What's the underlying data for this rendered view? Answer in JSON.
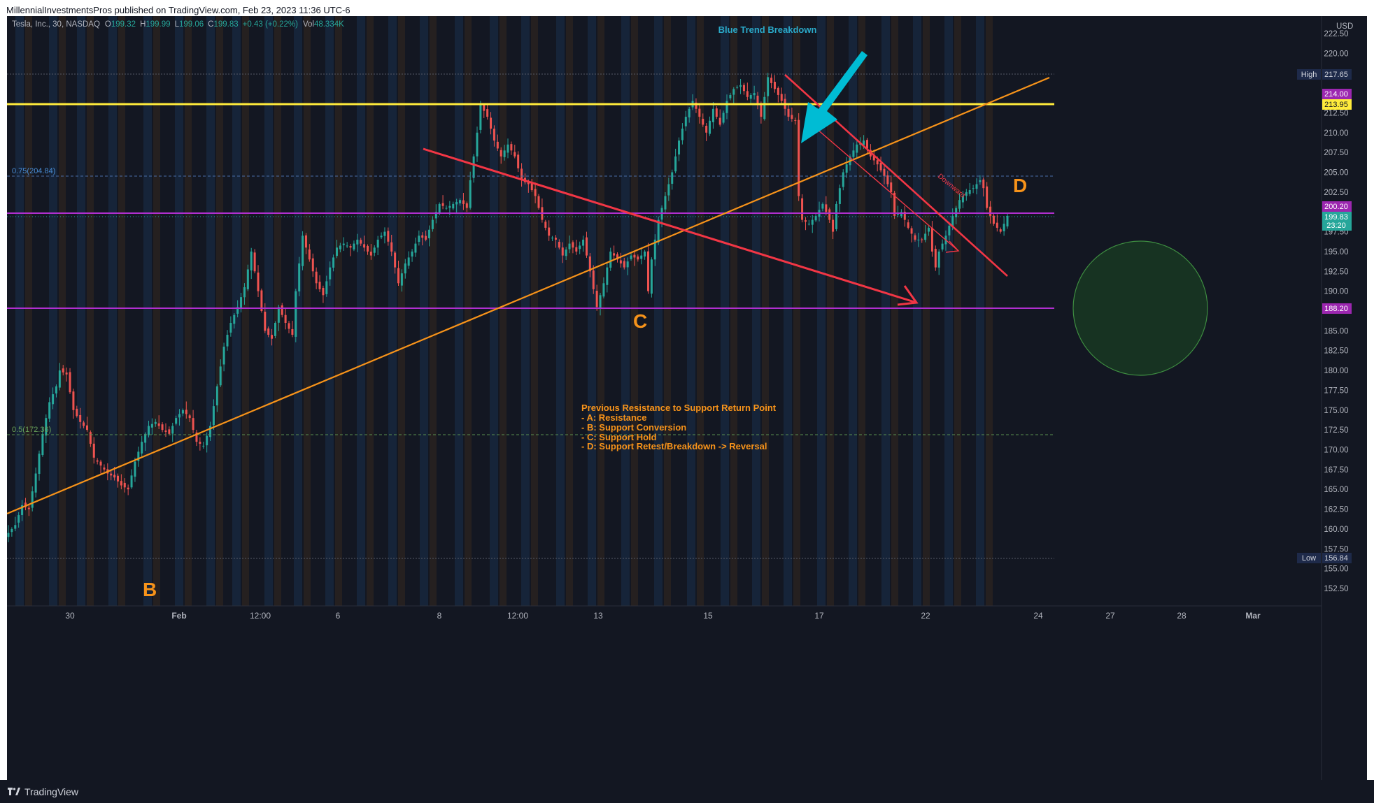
{
  "header": {
    "published": "MillennialInvestmentsPros published on TradingView.com, Feb 23, 2023 11:36 UTC-6"
  },
  "legend": {
    "symbol": "Tesla, Inc., 30, NASDAQ",
    "o_label": "O",
    "o_val": "199.32",
    "h_label": "H",
    "h_val": "199.99",
    "l_label": "L",
    "l_val": "199.06",
    "c_label": "C",
    "c_val": "199.83",
    "change": "+0.43 (+0.22%)",
    "vol_label": "Vol",
    "vol_val": "48.334K"
  },
  "annotations": {
    "title": "Blue Trend Breakdown",
    "label_b": "B",
    "label_c": "C",
    "label_d": "D",
    "downward": "Downward",
    "note_lines": [
      "Previous Resistance to Support Return Point",
      "- A: Resistance",
      "- B: Support Conversion",
      "- C: Support Hold",
      "- D: Support Retest/Breakdown -> Reversal"
    ],
    "fib_075": "0.75(204.84)",
    "fib_05": "0.5(172.36)"
  },
  "axis": {
    "currency": "USD",
    "high_label": "High",
    "high_val": "217.65",
    "low_label": "Low",
    "low_val": "156.84",
    "tag_214": "214.00",
    "tag_21395": "213.95",
    "tag_20020": "200.20",
    "tag_last": "199.83",
    "tag_timer": "23:20",
    "tag_18820": "188.20"
  },
  "footer": {
    "brand": "TradingView"
  },
  "colors": {
    "background": "#131722",
    "up": "#26a69a",
    "down": "#ef5350",
    "orange": "#f7931a",
    "yellow": "#ffeb3b",
    "magenta": "#9c27b0",
    "red_line": "#f23645",
    "cyan_arrow": "#00bcd4",
    "circle": "#1b5e20"
  },
  "chart_data": {
    "type": "candlestick",
    "symbol": "Tesla, Inc.",
    "interval": "30",
    "exchange": "NASDAQ",
    "ylim": [
      151.0,
      224.0
    ],
    "y_ticks": [
      152.5,
      155.0,
      157.5,
      160.0,
      162.5,
      165.0,
      167.5,
      170.0,
      172.5,
      175.0,
      177.5,
      180.0,
      182.5,
      185.0,
      187.5,
      190.0,
      192.5,
      195.0,
      197.5,
      200.0,
      202.5,
      205.0,
      207.5,
      210.0,
      212.5,
      215.0,
      217.5,
      220.0,
      222.5
    ],
    "x_tick_labels": [
      "30",
      "Feb",
      "12:00",
      "6",
      "8",
      "12:00",
      "13",
      "15",
      "17",
      "22",
      "24",
      "27",
      "28",
      "Mar"
    ],
    "price_path": [
      [
        0,
        159.5
      ],
      [
        2,
        160.5
      ],
      [
        4,
        163.0
      ],
      [
        6,
        162.5
      ],
      [
        8,
        167.0
      ],
      [
        10,
        172.0
      ],
      [
        12,
        176.0
      ],
      [
        14,
        178.0
      ],
      [
        15,
        180.0
      ],
      [
        17,
        179.5
      ],
      [
        19,
        175.0
      ],
      [
        21,
        173.5
      ],
      [
        23,
        172.5
      ],
      [
        25,
        169.0
      ],
      [
        27,
        168.0
      ],
      [
        29,
        167.0
      ],
      [
        31,
        166.5
      ],
      [
        33,
        165.5
      ],
      [
        35,
        165.0
      ],
      [
        37,
        168.5
      ],
      [
        39,
        171.0
      ],
      [
        41,
        173.0
      ],
      [
        43,
        173.5
      ],
      [
        45,
        172.5
      ],
      [
        47,
        172.0
      ],
      [
        49,
        174.0
      ],
      [
        51,
        175.0
      ],
      [
        53,
        174.0
      ],
      [
        55,
        171.0
      ],
      [
        57,
        170.5
      ],
      [
        59,
        173.0
      ],
      [
        61,
        178.0
      ],
      [
        63,
        183.0
      ],
      [
        65,
        186.0
      ],
      [
        67,
        188.0
      ],
      [
        69,
        190.5
      ],
      [
        71,
        195.0
      ],
      [
        73,
        190.0
      ],
      [
        75,
        185.0
      ],
      [
        77,
        184.0
      ],
      [
        79,
        188.0
      ],
      [
        81,
        186.0
      ],
      [
        83,
        184.5
      ],
      [
        84,
        190.0
      ],
      [
        86,
        197.0
      ],
      [
        88,
        194.0
      ],
      [
        90,
        191.0
      ],
      [
        92,
        189.5
      ],
      [
        94,
        193.0
      ],
      [
        96,
        195.5
      ],
      [
        98,
        196.0
      ],
      [
        100,
        195.5
      ],
      [
        102,
        196.5
      ],
      [
        104,
        195.5
      ],
      [
        106,
        194.5
      ],
      [
        108,
        196.5
      ],
      [
        110,
        197.5
      ],
      [
        112,
        195.0
      ],
      [
        114,
        191.0
      ],
      [
        116,
        193.5
      ],
      [
        118,
        195.0
      ],
      [
        120,
        197.0
      ],
      [
        122,
        196.5
      ],
      [
        124,
        199.0
      ],
      [
        126,
        201.0
      ],
      [
        128,
        200.5
      ],
      [
        130,
        201.0
      ],
      [
        132,
        201.5
      ],
      [
        134,
        200.5
      ],
      [
        135,
        204.0
      ],
      [
        137,
        210.0
      ],
      [
        138,
        213.5
      ],
      [
        140,
        212.0
      ],
      [
        142,
        209.0
      ],
      [
        144,
        207.0
      ],
      [
        146,
        208.5
      ],
      [
        148,
        207.0
      ],
      [
        150,
        204.0
      ],
      [
        152,
        203.5
      ],
      [
        154,
        202.0
      ],
      [
        156,
        199.0
      ],
      [
        158,
        197.0
      ],
      [
        160,
        196.5
      ],
      [
        162,
        194.5
      ],
      [
        164,
        196.0
      ],
      [
        166,
        195.0
      ],
      [
        168,
        196.5
      ],
      [
        170,
        192.5
      ],
      [
        172,
        188.0
      ],
      [
        174,
        191.0
      ],
      [
        176,
        195.0
      ],
      [
        178,
        194.0
      ],
      [
        180,
        193.0
      ],
      [
        182,
        194.5
      ],
      [
        184,
        194.0
      ],
      [
        186,
        195.0
      ],
      [
        187,
        190.0
      ],
      [
        188,
        194.0
      ],
      [
        190,
        199.0
      ],
      [
        192,
        202.0
      ],
      [
        194,
        205.0
      ],
      [
        196,
        209.0
      ],
      [
        198,
        212.0
      ],
      [
        200,
        214.0
      ],
      [
        202,
        212.0
      ],
      [
        204,
        210.0
      ],
      [
        206,
        213.0
      ],
      [
        208,
        211.0
      ],
      [
        210,
        214.0
      ],
      [
        212,
        215.5
      ],
      [
        214,
        216.0
      ],
      [
        216,
        214.5
      ],
      [
        218,
        215.0
      ],
      [
        220,
        212.0
      ],
      [
        222,
        217.0
      ],
      [
        224,
        215.5
      ],
      [
        226,
        214.0
      ],
      [
        228,
        212.0
      ],
      [
        230,
        211.5
      ],
      [
        231,
        202.0
      ],
      [
        232,
        199.0
      ],
      [
        234,
        198.5
      ],
      [
        236,
        199.5
      ],
      [
        238,
        201.0
      ],
      [
        240,
        199.0
      ],
      [
        241,
        197.5
      ],
      [
        242,
        201.0
      ],
      [
        244,
        205.0
      ],
      [
        246,
        207.0
      ],
      [
        248,
        208.5
      ],
      [
        250,
        209.0
      ],
      [
        252,
        207.0
      ],
      [
        254,
        206.0
      ],
      [
        256,
        204.5
      ],
      [
        258,
        202.5
      ],
      [
        259,
        199.5
      ],
      [
        261,
        200.0
      ],
      [
        263,
        198.0
      ],
      [
        265,
        196.5
      ],
      [
        267,
        196.5
      ],
      [
        269,
        198.0
      ],
      [
        270,
        195.0
      ],
      [
        271,
        193.0
      ],
      [
        272,
        195.0
      ],
      [
        274,
        197.0
      ],
      [
        276,
        199.5
      ],
      [
        278,
        201.5
      ],
      [
        280,
        202.5
      ],
      [
        282,
        203.0
      ],
      [
        284,
        204.0
      ],
      [
        285,
        203.0
      ],
      [
        286,
        200.5
      ],
      [
        288,
        198.5
      ],
      [
        290,
        197.5
      ],
      [
        292,
        199.5
      ]
    ],
    "lines": {
      "resistance_A": 213.95,
      "level_214": 214.0,
      "level_200_20": 200.2,
      "level_188_20": 188.2,
      "fib_0_75": 204.84,
      "fib_0_5": 172.36,
      "high": 217.65,
      "low": 156.84
    },
    "last_price": 199.83
  }
}
